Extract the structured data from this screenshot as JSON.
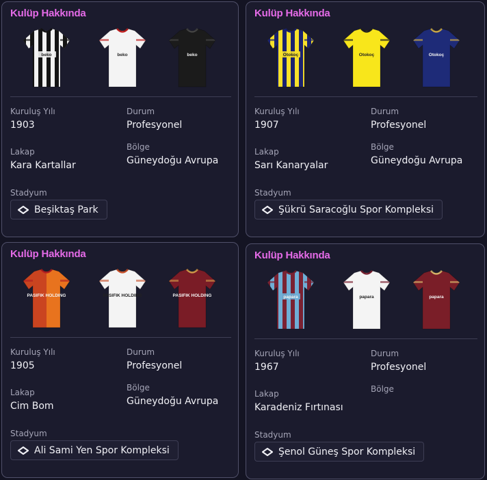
{
  "cards": [
    {
      "title": "Kulüp Hakkında",
      "jerseys": [
        {
          "icon": "jersey-icon",
          "style": "stripes",
          "primary": "#F2F2F2",
          "secondary": "#141414",
          "sponsor": "beko"
        },
        {
          "icon": "jersey-icon",
          "style": "plain",
          "primary": "#F4F4F4",
          "secondary": "#C02020",
          "sponsor": "beko"
        },
        {
          "icon": "jersey-icon",
          "style": "plain",
          "primary": "#1B1B1B",
          "secondary": "#444444",
          "sponsor": "beko"
        }
      ],
      "founded_label": "Kuruluş Yılı",
      "founded": "1903",
      "status_label": "Durum",
      "status": "Profesyonel",
      "nickname_label": "Lakap",
      "nickname": "Kara Kartallar",
      "region_label": "Bölge",
      "region": "Güneydoğu Avrupa",
      "stadium_label": "Stadyum",
      "stadium": "Beşiktaş Park",
      "stadium_icon": "stadium-icon"
    },
    {
      "title": "Kulüp Hakkında",
      "jerseys": [
        {
          "icon": "jersey-icon",
          "style": "stripes",
          "primary": "#F7E12A",
          "secondary": "#1A2270",
          "sponsor": "Otokoç"
        },
        {
          "icon": "jersey-icon",
          "style": "plain",
          "primary": "#F8E61B",
          "secondary": "#222222",
          "sponsor": "Otokoç"
        },
        {
          "icon": "jersey-icon",
          "style": "plain",
          "primary": "#1E2B78",
          "secondary": "#C9A845",
          "sponsor": "Otokoç"
        }
      ],
      "founded_label": "Kuruluş Yılı",
      "founded": "1907",
      "status_label": "Durum",
      "status": "Profesyonel",
      "nickname_label": "Lakap",
      "nickname": "Sarı Kanaryalar",
      "region_label": "Bölge",
      "region": "Güneydoğu Avrupa",
      "stadium_label": "Stadyum",
      "stadium": "Şükrü Saracoğlu Spor Kompleksi",
      "stadium_icon": "stadium-icon"
    },
    {
      "title": "Kulüp Hakkında",
      "jerseys": [
        {
          "icon": "jersey-icon",
          "style": "halves",
          "primary": "#E8731E",
          "secondary": "#B01E22",
          "sponsor": "PASIFIK HOLDING"
        },
        {
          "icon": "jersey-icon",
          "style": "plain",
          "primary": "#F4F4F4",
          "secondary": "#C8502A",
          "sponsor": "PASIFIK HOLDING"
        },
        {
          "icon": "jersey-icon",
          "style": "plain",
          "primary": "#7A1C26",
          "secondary": "#D09A4A",
          "sponsor": "PASIFIK HOLDING"
        }
      ],
      "founded_label": "Kuruluş Yılı",
      "founded": "1905",
      "status_label": "Durum",
      "status": "Profesyonel",
      "nickname_label": "Lakap",
      "nickname": "Cim Bom",
      "region_label": "Bölge",
      "region": "Güneydoğu Avrupa",
      "stadium_label": "Stadyum",
      "stadium": "Ali Sami Yen Spor Kompleksi",
      "stadium_icon": "stadium-icon"
    },
    {
      "title": "Kulüp Hakkında",
      "jerseys": [
        {
          "icon": "jersey-icon",
          "style": "stripes",
          "primary": "#6FAED6",
          "secondary": "#7A2232",
          "sponsor": "papara"
        },
        {
          "icon": "jersey-icon",
          "style": "plain",
          "primary": "#F4F4F4",
          "secondary": "#7A2232",
          "sponsor": "papara"
        },
        {
          "icon": "jersey-icon",
          "style": "plain",
          "primary": "#7A1E28",
          "secondary": "#D7B56A",
          "sponsor": "papara"
        }
      ],
      "founded_label": "Kuruluş Yılı",
      "founded": "1967",
      "status_label": "Durum",
      "status": "Profesyonel",
      "nickname_label": "Lakap",
      "nickname": "Karadeniz Fırtınası",
      "region_label": "Bölge",
      "region": "",
      "stadium_label": "Stadyum",
      "stadium": "Şenol Güneş Spor Kompleksi",
      "stadium_icon": "stadium-icon"
    }
  ]
}
